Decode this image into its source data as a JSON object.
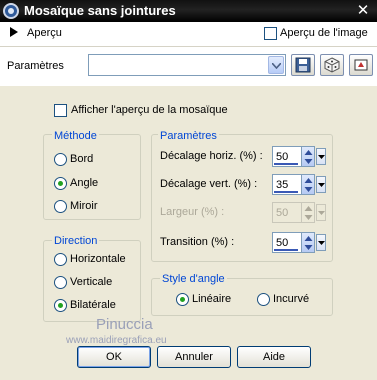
{
  "window": {
    "title": "Mosaïque sans jointures"
  },
  "preview": {
    "label": "Aperçu",
    "image_checkbox_label": "Aperçu de l'image",
    "image_checkbox_checked": false
  },
  "params": {
    "label": "Paramètres",
    "preset_value": ""
  },
  "show_mosaic_preview": {
    "label": "Afficher l'aperçu de la mosaïque",
    "checked": false
  },
  "method": {
    "title": "Méthode",
    "options": [
      "Bord",
      "Angle",
      "Miroir"
    ],
    "selected": "Angle"
  },
  "parameters": {
    "title": "Paramètres",
    "fields": [
      {
        "label": "Décalage horiz. (%) :",
        "value": "50",
        "enabled": true
      },
      {
        "label": "Décalage vert. (%) :",
        "value": "35",
        "enabled": true
      },
      {
        "label": "Largeur (%) :",
        "value": "50",
        "enabled": false
      },
      {
        "label": "Transition (%) :",
        "value": "50",
        "enabled": true
      }
    ]
  },
  "direction": {
    "title": "Direction",
    "options": [
      "Horizontale",
      "Verticale",
      "Bilatérale"
    ],
    "selected": "Bilatérale"
  },
  "angle_style": {
    "title": "Style d'angle",
    "options": [
      "Linéaire",
      "Incurvé"
    ],
    "selected": "Linéaire"
  },
  "watermark": {
    "name": "Pinuccia",
    "url": "www.maidiregrafica.eu"
  },
  "buttons": {
    "ok": "OK",
    "cancel": "Annuler",
    "help": "Aide"
  }
}
